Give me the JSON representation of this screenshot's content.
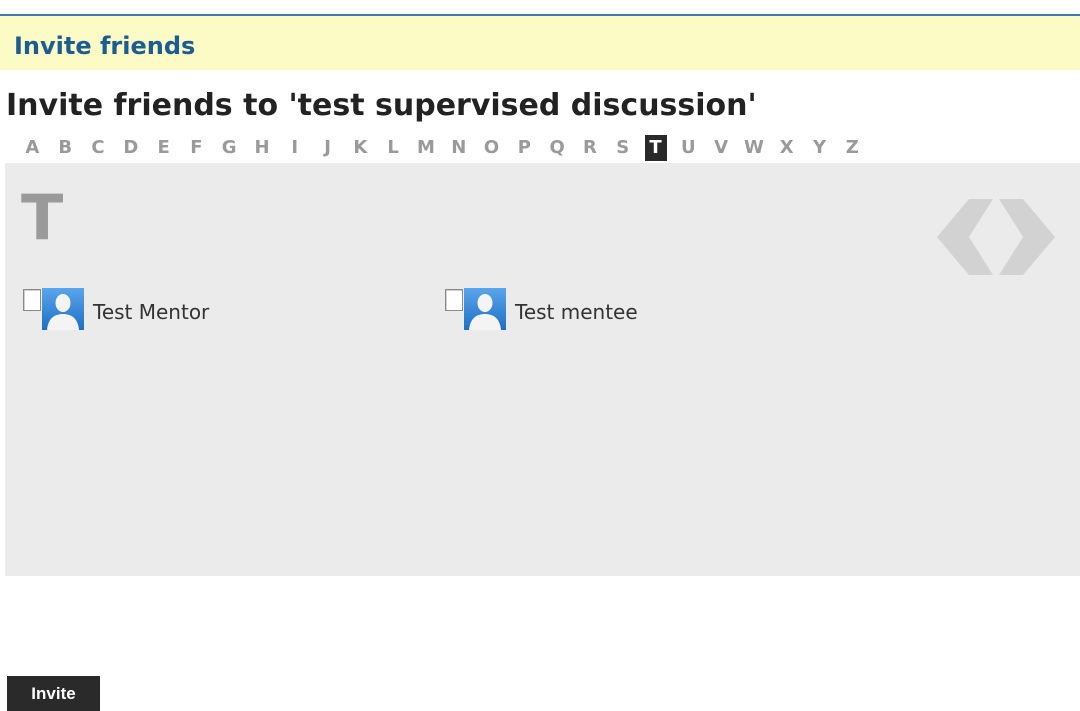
{
  "banner": {
    "title": "Invite friends"
  },
  "page": {
    "title": "Invite friends to 'test supervised discussion'"
  },
  "alphabet": {
    "letters": [
      "A",
      "B",
      "C",
      "D",
      "E",
      "F",
      "G",
      "H",
      "I",
      "J",
      "K",
      "L",
      "M",
      "N",
      "O",
      "P",
      "Q",
      "R",
      "S",
      "T",
      "U",
      "V",
      "W",
      "X",
      "Y",
      "Z"
    ],
    "selected": "T"
  },
  "section": {
    "letter": "T"
  },
  "nav": {
    "prev_icon": "chevron-left-icon",
    "next_icon": "chevron-right-icon"
  },
  "friends": [
    {
      "name": "Test Mentor",
      "checked": false,
      "avatar_icon": "user-avatar-icon"
    },
    {
      "name": "Test mentee",
      "checked": false,
      "avatar_icon": "user-avatar-icon"
    }
  ],
  "actions": {
    "invite_label": "Invite"
  },
  "colors": {
    "banner_bg": "#fcfbc6",
    "banner_text": "#1b5c93",
    "panel_bg": "#ebebeb",
    "active_letter_bg": "#2a2a2a",
    "button_bg": "#2a2a2a"
  }
}
